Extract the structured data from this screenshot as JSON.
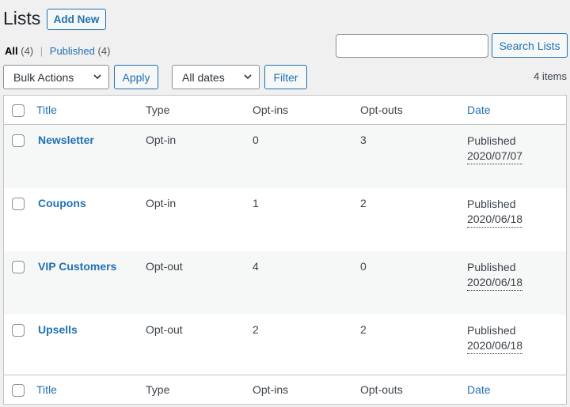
{
  "header": {
    "title": "Lists",
    "add_new_label": "Add New"
  },
  "views": {
    "all_label": "All",
    "all_count": "(4)",
    "separator": "|",
    "published_label": "Published",
    "published_count": "(4)"
  },
  "search": {
    "value": "",
    "placeholder": "",
    "button_label": "Search Lists"
  },
  "toolbar": {
    "bulk_actions_selected": "Bulk Actions",
    "apply_label": "Apply",
    "dates_selected": "All dates",
    "filter_label": "Filter",
    "item_count": "4 items"
  },
  "table": {
    "columns": {
      "title": "Title",
      "type": "Type",
      "optins": "Opt-ins",
      "optouts": "Opt-outs",
      "date": "Date"
    },
    "rows": [
      {
        "title": "Newsletter",
        "type": "Opt-in",
        "optins": "0",
        "optouts": "3",
        "status": "Published",
        "date": "2020/07/07"
      },
      {
        "title": "Coupons",
        "type": "Opt-in",
        "optins": "1",
        "optouts": "2",
        "status": "Published",
        "date": "2020/06/18"
      },
      {
        "title": "VIP Customers",
        "type": "Opt-out",
        "optins": "4",
        "optouts": "0",
        "status": "Published",
        "date": "2020/06/18"
      },
      {
        "title": "Upsells",
        "type": "Opt-out",
        "optins": "2",
        "optouts": "2",
        "status": "Published",
        "date": "2020/06/18"
      }
    ]
  },
  "colors": {
    "link": "#2271b1",
    "text": "#3c434a",
    "background": "#f0f0f1",
    "border": "#c3c4c7"
  },
  "icons": {
    "select_arrow": "chevron-down-icon"
  }
}
